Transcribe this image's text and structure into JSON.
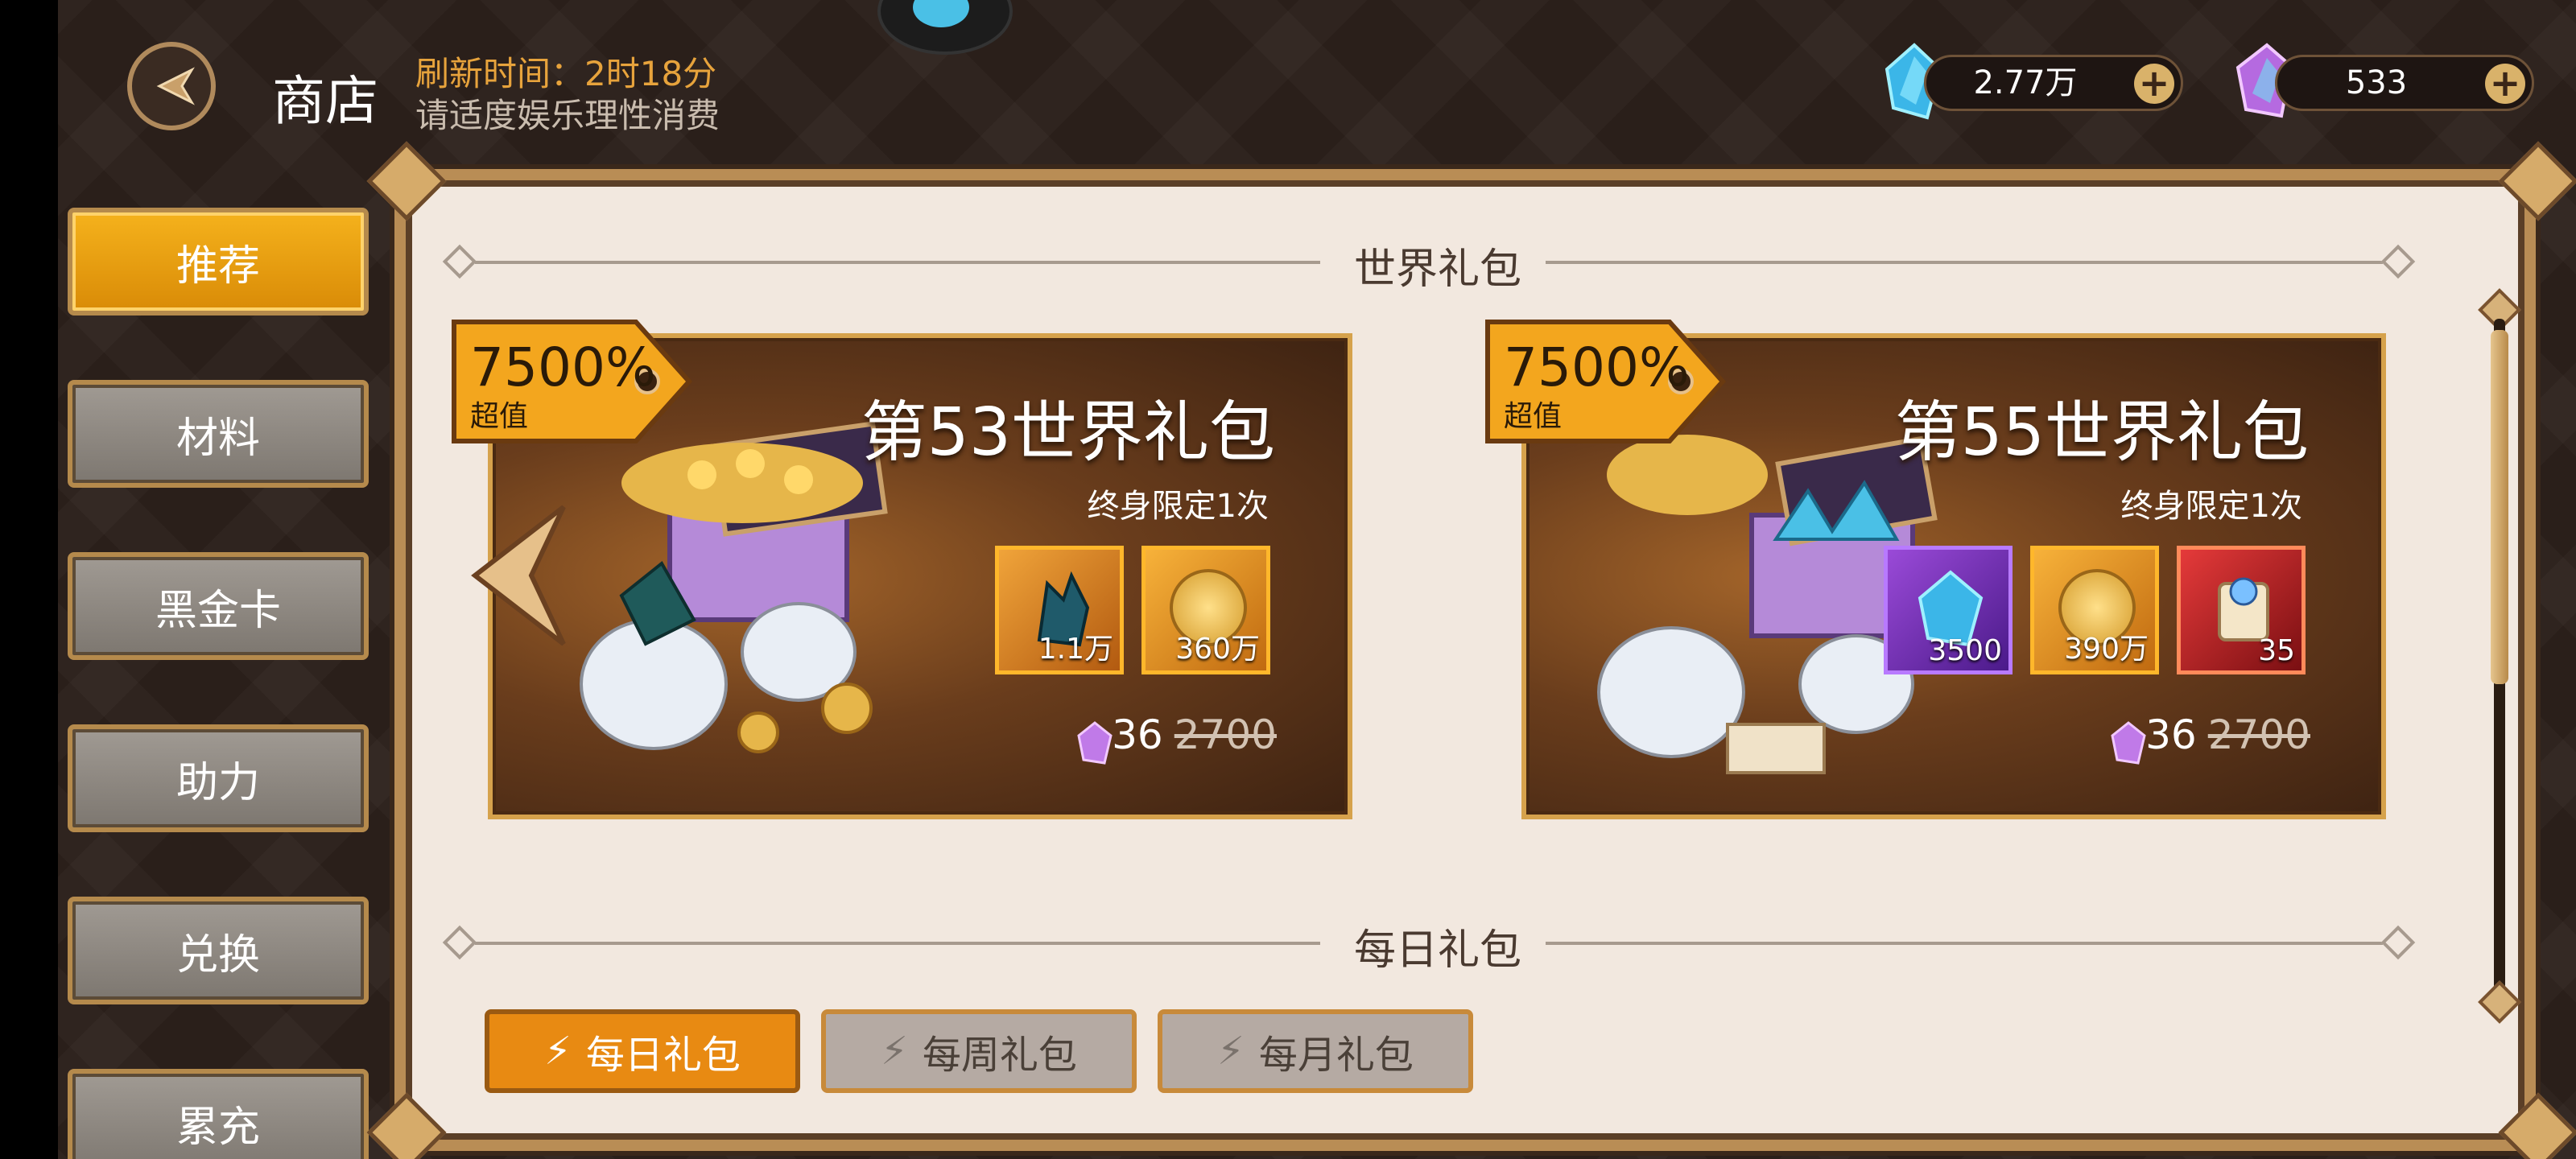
{
  "header": {
    "title": "商店",
    "refresh_text": "刷新时间：2时18分",
    "notice": "请适度娱乐理性消费"
  },
  "currencies": [
    {
      "icon": "blue-crystal-icon",
      "value": "2.77万"
    },
    {
      "icon": "purple-crystal-icon",
      "value": "533"
    }
  ],
  "sidebar": {
    "items": [
      {
        "label": "推荐",
        "active": true
      },
      {
        "label": "材料"
      },
      {
        "label": "黑金卡"
      },
      {
        "label": "助力"
      },
      {
        "label": "兑换"
      },
      {
        "label": "累充"
      }
    ]
  },
  "sections": {
    "world": "世界礼包",
    "daily": "每日礼包"
  },
  "packs": [
    {
      "name": "第53世界礼包",
      "limit": "终身限定1次",
      "badge_pct": "7500%",
      "badge_sub": "超值",
      "price": "36",
      "old_price": "2700",
      "items": [
        {
          "icon": "dark-shard-icon",
          "count": "1.1万"
        },
        {
          "icon": "gold-coin-icon",
          "count": "360万"
        }
      ]
    },
    {
      "name": "第55世界礼包",
      "limit": "终身限定1次",
      "badge_pct": "7500%",
      "badge_sub": "超值",
      "price": "36",
      "old_price": "2700",
      "items": [
        {
          "icon": "blue-crystal-icon",
          "count": "3500"
        },
        {
          "icon": "gold-coin-icon",
          "count": "390万"
        },
        {
          "icon": "scroll-icon",
          "count": "35"
        }
      ]
    }
  ],
  "tabs": [
    {
      "label": "每日礼包",
      "active": true
    },
    {
      "label": "每周礼包"
    },
    {
      "label": "每月礼包"
    }
  ],
  "colors": {
    "accent_orange": "#e88a12",
    "gold_border": "#d6a24c",
    "panel_bg": "#f2e8df"
  }
}
